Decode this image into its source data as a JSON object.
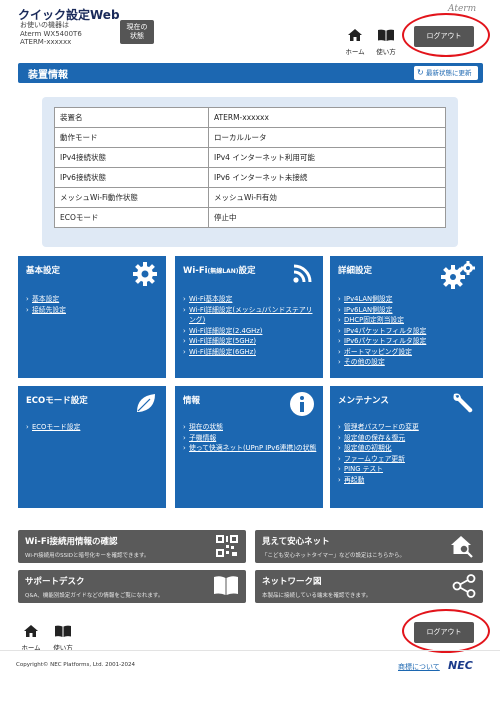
{
  "header": {
    "app_title": "クイック設定Web",
    "device_caption": "お使いの機器は",
    "device_model": "Aterm WX5400T6",
    "device_name": "ATERM-xxxxxx",
    "status_button": "現在の\n状態",
    "brand": "Aterm",
    "home_label": "ホーム",
    "help_label": "使い方",
    "logout_label": "ログアウト"
  },
  "section": {
    "title": "装置情報",
    "refresh_label": "最新状態に更新"
  },
  "info_table": [
    {
      "key": "装置名",
      "value": "ATERM-xxxxxx"
    },
    {
      "key": "動作モード",
      "value": "ローカルルータ"
    },
    {
      "key": "IPv4接続状態",
      "value": "IPv4 インターネット利用可能"
    },
    {
      "key": "IPv6接続状態",
      "value": "IPv6 インターネット未接続"
    },
    {
      "key": "メッシュWi-Fi動作状態",
      "value": "メッシュWi-Fi有効"
    },
    {
      "key": "ECOモード",
      "value": "停止中"
    }
  ],
  "tiles": {
    "basic": {
      "title": "基本設定",
      "links": [
        "基本設定",
        "接続先設定"
      ]
    },
    "wifi": {
      "title_main": "Wi-Fi",
      "title_small": "(無線LAN)",
      "title_tail": "設定",
      "links": [
        "Wi-Fi基本設定",
        "Wi-Fi詳細設定(メッシュ/バンドステアリング)",
        "Wi-Fi詳細設定(2.4GHz)",
        "Wi-Fi詳細設定(5GHz)",
        "Wi-Fi詳細設定(6GHz)"
      ]
    },
    "detail": {
      "title": "詳細設定",
      "links": [
        "IPv4LAN側設定",
        "IPv6LAN側設定",
        "DHCP固定割当設定",
        "IPv4パケットフィルタ設定",
        "IPv6パケットフィルタ設定",
        "ポートマッピング設定",
        "その他の設定"
      ]
    },
    "eco": {
      "title": "ECOモード設定",
      "links": [
        "ECOモード設定"
      ]
    },
    "info": {
      "title": "情報",
      "links": [
        "現在の状態",
        "子機情報",
        "使って快適ネット(UPnP IPv6連携)の状態"
      ]
    },
    "maintenance": {
      "title": "メンテナンス",
      "links": [
        "管理者パスワードの変更",
        "設定値の保存＆復元",
        "設定値の初期化",
        "ファームウェア更新",
        "PING テスト",
        "再起動"
      ]
    }
  },
  "panels": {
    "wifi_confirm": {
      "title": "Wi-Fi接続用情報の確認",
      "desc": "Wi-Fi接続用のSSIDと暗号化キーを確認できます。"
    },
    "safe_net": {
      "title": "見えて安心ネット",
      "desc": "「こども安心ネットタイマー」などの設定はこちらから。"
    },
    "support": {
      "title": "サポートデスク",
      "desc": "Q&A、機能別設定ガイドなどの情報をご覧になれます。"
    },
    "network_map": {
      "title": "ネットワーク図",
      "desc": "本製品に接続している端末を確認できます。"
    }
  },
  "footer": {
    "home_label": "ホーム",
    "help_label": "使い方",
    "logout_label": "ログアウト",
    "copyright": "Copyright© NEC Platforms, Ltd. 2001-2024",
    "trademark_link": "商標について",
    "brand": "NEC"
  },
  "colors": {
    "primary": "#1c67b1",
    "panel": "#5a5a5a",
    "highlight": "#e2141b"
  }
}
